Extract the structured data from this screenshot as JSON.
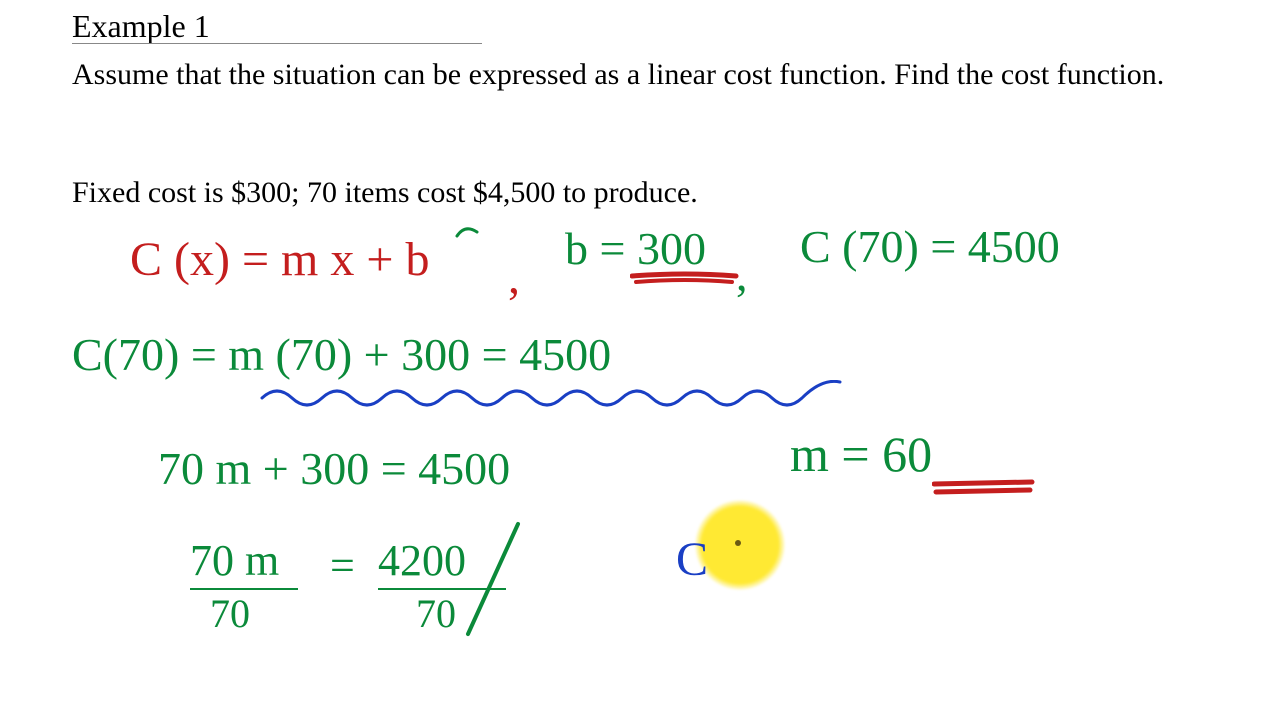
{
  "typed": {
    "title": "Example 1",
    "prompt": "Assume that the situation can be expressed as a linear cost function.  Find the cost function.",
    "given": "Fixed cost is $300; 70 items cost $4,500 to produce."
  },
  "hand": {
    "cx_eq": "C (x) = m x + b",
    "comma1": ",",
    "b_eq": "b = 300",
    "comma2": ",",
    "c70_eq": "C (70) = 4500",
    "line2": "C(70) = m (70) + 300 = 4500",
    "line3": "70 m + 300 = 4500",
    "m_eq": "m = 60",
    "frac_left_top": "70 m",
    "frac_left_bot": "70",
    "eq_sign": "=",
    "frac_right_top": "4200",
    "frac_right_bot": "70",
    "blue_C": "C"
  },
  "colors": {
    "green": "#0b8a3a",
    "red": "#c41e1e",
    "blue": "#1a3fc4",
    "highlight": "#ffe933"
  }
}
